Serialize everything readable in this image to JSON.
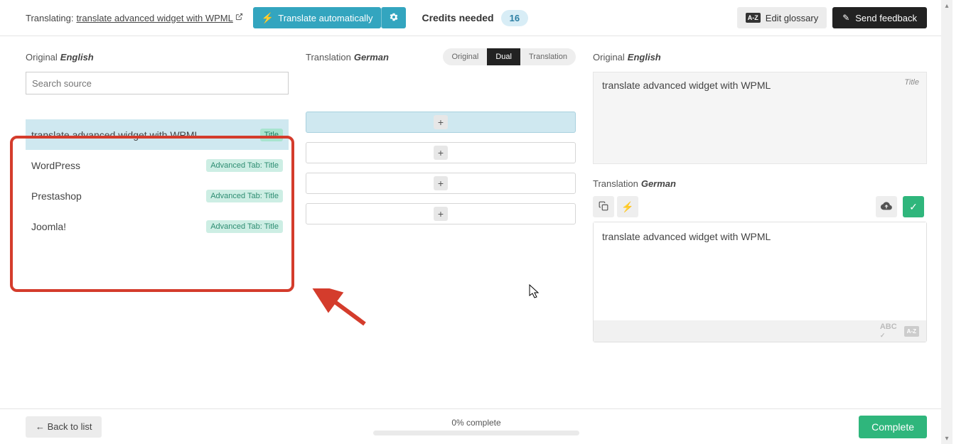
{
  "topbar": {
    "translating_label": "Translating:",
    "translating_link": "translate advanced widget with WPML",
    "translate_auto": "Translate automatically",
    "credits_label": "Credits needed",
    "credits_value": "16",
    "edit_glossary": "Edit glossary",
    "send_feedback": "Send feedback"
  },
  "columns": {
    "original_label": "Original",
    "translation_label": "Translation",
    "lang_english": "English",
    "lang_german": "German"
  },
  "view_toggle": {
    "original": "Original",
    "dual": "Dual",
    "translation": "Translation"
  },
  "search": {
    "placeholder": "Search source"
  },
  "tags": {
    "title": "Title",
    "adv_title": "Advanced Tab: Title"
  },
  "source_rows": [
    {
      "text": "translate advanced widget with WPML",
      "tag": "title",
      "selected": true
    },
    {
      "text": "WordPress",
      "tag": "adv",
      "selected": false
    },
    {
      "text": "Prestashop",
      "tag": "adv",
      "selected": false
    },
    {
      "text": "Joomla!",
      "tag": "adv",
      "selected": false
    }
  ],
  "right_panel": {
    "original_text": "translate advanced widget with WPML",
    "title_label": "Title",
    "translation_text": "translate advanced widget with WPML",
    "abc_label": "ABC"
  },
  "bottombar": {
    "back": "← Back to list",
    "progress": "0% complete",
    "complete": "Complete"
  }
}
